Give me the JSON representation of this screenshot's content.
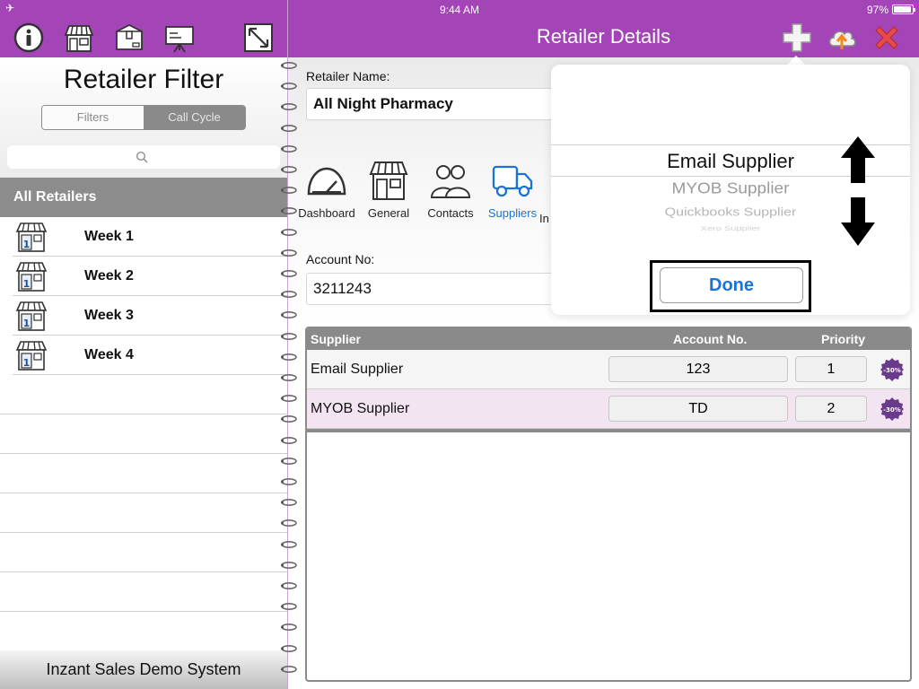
{
  "status_bar": {
    "time": "9:44 AM",
    "battery": "97%"
  },
  "nav": {
    "title": "Retailer Details",
    "left_tools": [
      "info-icon",
      "store-icon",
      "box-icon",
      "presentation-icon",
      "expand-icon"
    ],
    "right_tools": [
      "add-icon",
      "cloud-upload-icon",
      "close-icon"
    ]
  },
  "left_pane": {
    "title": "Retailer Filter",
    "segments": [
      "Filters",
      "Call Cycle"
    ],
    "selected_segment": "Call Cycle",
    "search_placeholder": "",
    "group_header": "All Retailers",
    "weeks": [
      "Week 1",
      "Week 2",
      "Week 3",
      "Week 4"
    ],
    "footer": "Inzant Sales Demo System"
  },
  "form": {
    "retailer_name_label": "Retailer Name:",
    "retailer_name": "All Night Pharmacy",
    "account_no_label": "Account No:",
    "account_no": "3211243"
  },
  "tabs": [
    {
      "label": "Dashboard",
      "icon": "gauge-icon"
    },
    {
      "label": "General",
      "icon": "store-icon"
    },
    {
      "label": "Contacts",
      "icon": "contacts-icon"
    },
    {
      "label": "Suppliers",
      "icon": "truck-icon",
      "active": true
    },
    {
      "label": "In",
      "icon": ""
    }
  ],
  "supplier_table": {
    "headers": [
      "Supplier",
      "Account No.",
      "Priority"
    ],
    "rows": [
      {
        "supplier": "Email Supplier",
        "account_no": "123",
        "priority": "1",
        "badge": "-30%"
      },
      {
        "supplier": "MYOB Supplier",
        "account_no": "TD",
        "priority": "2",
        "badge": "-30%"
      }
    ]
  },
  "picker": {
    "options": [
      "Email Supplier",
      "MYOB Supplier",
      "Quickbooks Supplier",
      "Xero Supplier"
    ],
    "selected": "Email Supplier",
    "done_label": "Done"
  },
  "colors": {
    "brand": "#a445b7",
    "accent": "#1a73d9",
    "header_gray": "#8a8a8a",
    "row_highlight": "#f2e4f1"
  }
}
